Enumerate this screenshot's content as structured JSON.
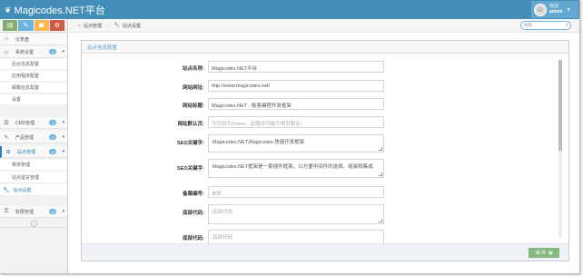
{
  "app": {
    "title": "Magicodes.NET平台"
  },
  "user": {
    "greeting": "欢迎",
    "name": "admin"
  },
  "sidebar": {
    "shortcuts": [
      {
        "icon": "chart-icon",
        "color": "#82af6f"
      },
      {
        "icon": "pencil-icon",
        "color": "#6fb3e0"
      },
      {
        "icon": "users-icon",
        "color": "#ffb752"
      },
      {
        "icon": "cogs-icon",
        "color": "#d15b47"
      }
    ],
    "items": [
      {
        "label": "仪表盘",
        "icon": "dashboard-icon"
      },
      {
        "label": "系统设置",
        "icon": "desktop-icon",
        "badge": "4"
      },
      {
        "label": "后台信息配置"
      },
      {
        "label": "应用程序配置"
      },
      {
        "label": "邮箱信息配置"
      },
      {
        "label": "设置"
      },
      {
        "label": "CMS管理",
        "icon": "list-icon",
        "badge": "4"
      },
      {
        "label": "产品管理",
        "icon": "edit-icon",
        "badge": "2"
      },
      {
        "label": "站点管理",
        "icon": "sitemap-icon",
        "badge": "3"
      },
      {
        "label": "菜单管理"
      },
      {
        "label": "站点留言管理"
      },
      {
        "label": "站点设置",
        "icon": "wrench-icon"
      },
      {
        "label": "权限管理",
        "icon": "key-icon",
        "badge": "2"
      }
    ],
    "collapse_icon": "double-angle-left-icon"
  },
  "breadcrumb": {
    "items": [
      "站点管理",
      "站点设置"
    ]
  },
  "search": {
    "placeholder": "搜索..."
  },
  "panel": {
    "title": "站点信息配置",
    "fields": [
      {
        "label": "站点名称:",
        "value": "Magicodes.NET平台"
      },
      {
        "label": "网站网址:",
        "value": "http://www.magicodes.net/"
      },
      {
        "label": "网站标题:",
        "value": "Magicodes.NET - 极客编程开发框架"
      },
      {
        "label": "网站默认页:",
        "value": "",
        "placeholder": "为空则为/home，此路径可能为相对路径。"
      },
      {
        "label": "SEO关键字:",
        "value": "Magicodes.NET,Magicodes,快速开发框架"
      },
      {
        "label": "SEO关键字:",
        "value": "Magicodes.NET框架是一套插件框架，以方便中间件的选择、组装和集成"
      },
      {
        "label": "备案编号:",
        "value": "",
        "placeholder": "未知"
      },
      {
        "label": "底部代码:",
        "value": "",
        "placeholder": "底部代码"
      },
      {
        "label": "底部代码:",
        "value": "",
        "placeholder": "底部代码"
      }
    ],
    "save_label": "保 存"
  }
}
